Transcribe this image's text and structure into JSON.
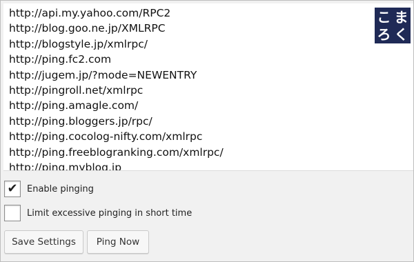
{
  "ping_list": {
    "urls": [
      "http://api.my.yahoo.com/RPC2",
      "http://blog.goo.ne.jp/XMLRPC",
      "http://blogstyle.jp/xmlrpc/",
      "http://ping.fc2.com",
      "http://jugem.jp/?mode=NEWENTRY",
      "http://pingroll.net/xmlrpc",
      "http://ping.amagle.com/",
      "http://ping.bloggers.jp/rpc/",
      "http://ping.cocolog-nifty.com/xmlrpc",
      "http://ping.freeblogranking.com/xmlrpc/",
      "http://ping.myblog.jp"
    ]
  },
  "logo": {
    "chars": [
      "こ",
      "ま",
      "ろ",
      "く"
    ],
    "color": "#1f2a56"
  },
  "options": {
    "enable_pinging": {
      "label": "Enable pinging",
      "checked": true
    },
    "limit_pinging": {
      "label": "Limit excessive pinging in short time",
      "checked": false
    }
  },
  "buttons": {
    "save": "Save Settings",
    "ping_now": "Ping Now"
  }
}
